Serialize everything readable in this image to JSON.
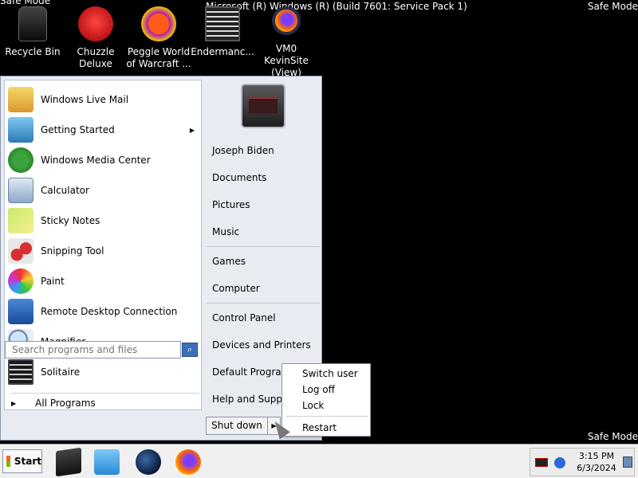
{
  "overlay": {
    "safe_mode_tl": "Safe Mode",
    "safe_mode_tr": "Safe Mode",
    "safe_mode_br": "Safe Mode",
    "build": "Microsoft (R) Windows (R) (Build 7601: Service Pack 1)"
  },
  "desktop": {
    "icons": [
      {
        "label": "Recycle Bin",
        "icon": "recycle-bin-icon"
      },
      {
        "label": "Chuzzle Deluxe",
        "icon": "chuzzle-icon"
      },
      {
        "label": "Peggle World of Warcraft ...",
        "icon": "peggle-icon"
      },
      {
        "label": "Endermanc...",
        "icon": "terminal-icon"
      },
      {
        "label": "VM0 KevinSite (View)",
        "icon": "firefox-icon"
      }
    ]
  },
  "start_menu": {
    "programs": [
      {
        "label": "Windows Live Mail",
        "icon": "mail-icon"
      },
      {
        "label": "Getting Started",
        "icon": "getting-started-icon",
        "has_submenu": true
      },
      {
        "label": "Windows Media Center",
        "icon": "media-center-icon"
      },
      {
        "label": "Calculator",
        "icon": "calculator-icon"
      },
      {
        "label": "Sticky Notes",
        "icon": "sticky-notes-icon"
      },
      {
        "label": "Snipping Tool",
        "icon": "scissors-icon"
      },
      {
        "label": "Paint",
        "icon": "paint-icon"
      },
      {
        "label": "Remote Desktop Connection",
        "icon": "remote-desktop-icon"
      },
      {
        "label": "Magnifier",
        "icon": "magnifier-icon"
      },
      {
        "label": "Solitaire",
        "icon": "solitaire-icon"
      }
    ],
    "all_programs": "All Programs",
    "search_placeholder": "Search programs and files",
    "right": {
      "user": "Joseph Biden",
      "documents": "Documents",
      "pictures": "Pictures",
      "music": "Music",
      "games": "Games",
      "computer": "Computer",
      "control_panel": "Control Panel",
      "devices": "Devices and Printers",
      "default_programs": "Default Programs",
      "help": "Help and Support"
    },
    "shutdown": "Shut down",
    "power_menu": {
      "switch_user": "Switch user",
      "log_off": "Log off",
      "lock": "Lock",
      "restart": "Restart"
    }
  },
  "taskbar": {
    "start": "Start",
    "time": "3:15 PM",
    "date": "6/3/2024"
  },
  "colors": {
    "desktop_bg": "#000000",
    "menu_left_bg": "#ffffff",
    "menu_right_bg": "#e8ecf2",
    "taskbar_bg": "#f0f0f0"
  }
}
